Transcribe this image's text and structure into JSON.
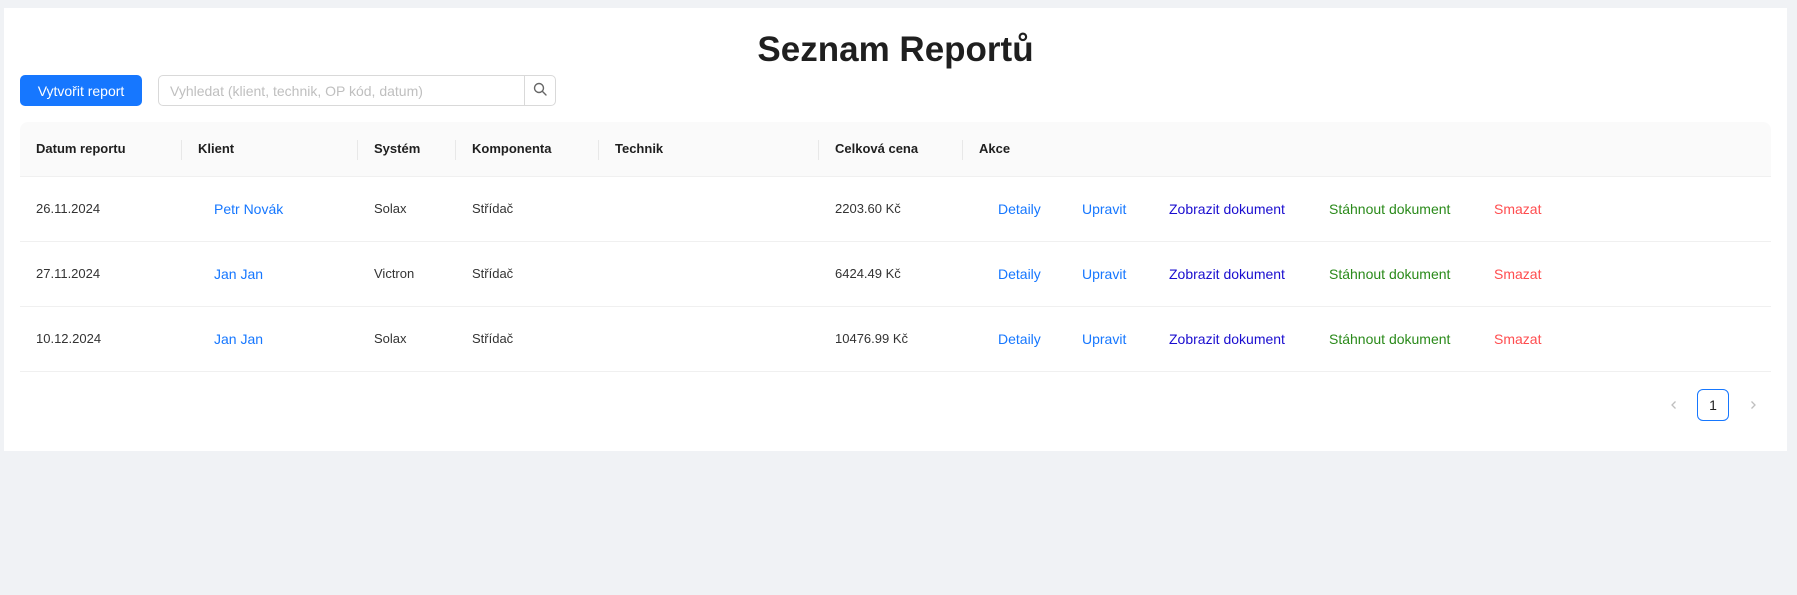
{
  "page": {
    "title": "Seznam Reportů"
  },
  "toolbar": {
    "create_label": "Vytvořit report",
    "search_placeholder": "Vyhledat (klient, technik, OP kód, datum)"
  },
  "table": {
    "columns": [
      "Datum reportu",
      "Klient",
      "Systém",
      "Komponenta",
      "Technik",
      "Celková cena",
      "Akce"
    ],
    "rows": [
      {
        "date": "26.11.2024",
        "client": "Petr Novák",
        "system": "Solax",
        "component": "Střídač",
        "technician": "",
        "price": "2203.60 Kč"
      },
      {
        "date": "27.11.2024",
        "client": "Jan Jan",
        "system": "Victron",
        "component": "Střídač",
        "technician": "",
        "price": "6424.49 Kč"
      },
      {
        "date": "10.12.2024",
        "client": "Jan Jan",
        "system": "Solax",
        "component": "Střídač",
        "technician": "",
        "price": "10476.99 Kč"
      }
    ],
    "actions": {
      "detail": "Detaily",
      "edit": "Upravit",
      "view": "Zobrazit dokument",
      "download": "Stáhnout dokument",
      "delete": "Smazat"
    }
  },
  "pagination": {
    "current_page": "1",
    "prev_icon": "chevron-left-icon",
    "next_icon": "chevron-right-icon"
  },
  "colors": {
    "primary": "#1677ff",
    "view_link": "#1a0dcf",
    "download_link": "#2a8a1a",
    "delete_link": "#ff4d4f"
  }
}
